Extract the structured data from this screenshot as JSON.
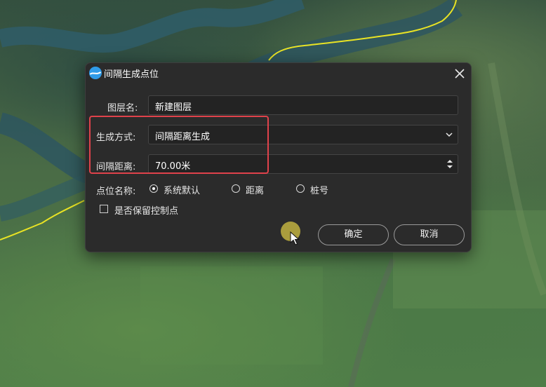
{
  "dialog": {
    "title": "间隔生成点位",
    "layer_name": {
      "label": "图层名:",
      "value": "新建图层"
    },
    "gen_method": {
      "label": "生成方式:",
      "value": "间隔距离生成"
    },
    "interval": {
      "label": "间隔距离:",
      "value": "70.00米"
    },
    "point_name": {
      "label": "点位名称:",
      "options": [
        {
          "label": "系统默认",
          "selected": true
        },
        {
          "label": "距离",
          "selected": false
        },
        {
          "label": "桩号",
          "selected": false
        }
      ]
    },
    "keep_control": {
      "label": "是否保留控制点",
      "checked": false
    },
    "ok_label": "确定",
    "cancel_label": "取消"
  },
  "colors": {
    "dialog_bg": "#2b2b2b",
    "highlight": "#e0424b",
    "track": "#e9e324",
    "cursor_halo": "#d6c444",
    "icon_blue": "#2f9be8"
  }
}
